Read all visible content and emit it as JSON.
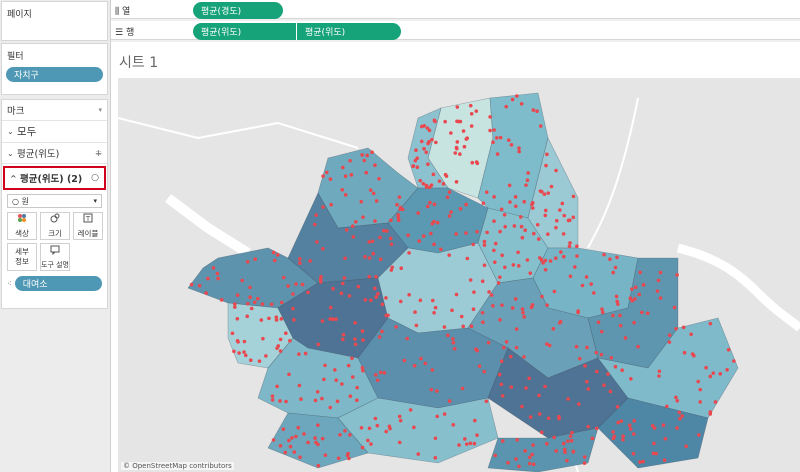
{
  "left": {
    "pages": {
      "title": "페이지"
    },
    "filters": {
      "title": "필터",
      "pill": "자치구"
    },
    "marks": {
      "title": "마크",
      "all": "모두",
      "lat1": "평균(위도)",
      "lat2": "평균(위도) (2)",
      "type": "원",
      "buttons": [
        {
          "label": "색상",
          "icon": "color-icon"
        },
        {
          "label": "크기",
          "icon": "size-icon"
        },
        {
          "label": "레이블",
          "icon": "label-icon"
        },
        {
          "label": "세부\n정보",
          "icon": "detail-icon"
        },
        {
          "label": "도구 설명",
          "icon": "tooltip-icon"
        }
      ],
      "field_pill": "대여소"
    }
  },
  "shelves": {
    "columns": {
      "label": "열",
      "pills": [
        "평균(경도)"
      ]
    },
    "rows": {
      "label": "행",
      "pills": [
        "평균(위도)",
        "평균(위도)"
      ]
    }
  },
  "sheet": {
    "title": "시트 1",
    "attribution": "© OpenStreetMap contributors"
  },
  "colors": {
    "pill_green": "#16a379",
    "pill_blue": "#4e98b5",
    "dot": "#e8484f",
    "highlight": "#d0021b"
  }
}
